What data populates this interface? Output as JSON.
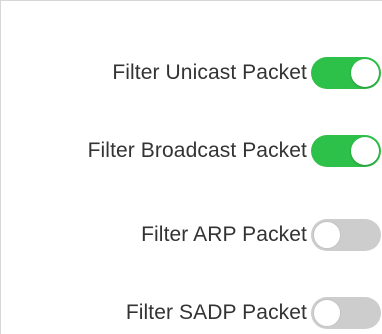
{
  "filters": [
    {
      "label": "Filter Unicast Packet",
      "enabled": true
    },
    {
      "label": "Filter Broadcast Packet",
      "enabled": true
    },
    {
      "label": "Filter ARP Packet",
      "enabled": false
    },
    {
      "label": "Filter SADP Packet",
      "enabled": false
    }
  ],
  "colors": {
    "toggle_on": "#2ec14a",
    "toggle_off": "#cdcdcd"
  }
}
